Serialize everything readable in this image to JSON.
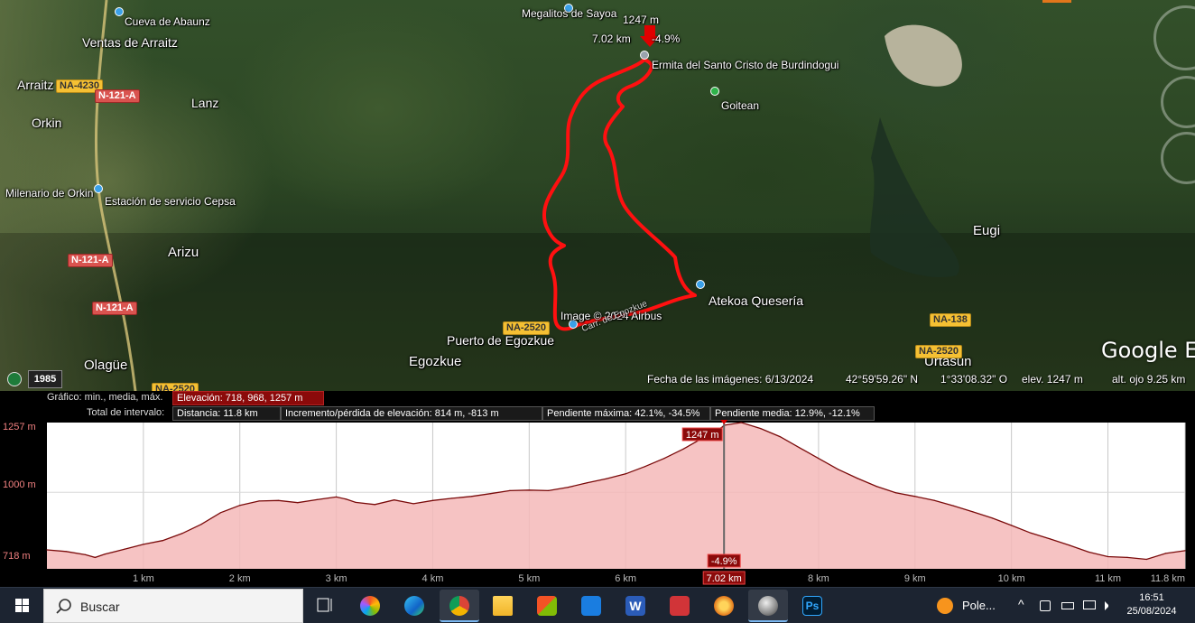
{
  "map": {
    "labels": {
      "cueva": "Cueva de Abaunz",
      "megalitos": "Megalitos de Sayoa",
      "ventas": "Ventas de Arraitz",
      "arraitz": "Arraitz",
      "lanz": "Lanz",
      "orkin": "Orkin",
      "milenario": "Milenario de Orkin",
      "cepsa": "Estación de servicio Cepsa",
      "arizu": "Arizu",
      "olague": "Olagüe",
      "ermita": "Ermita del Santo Cristo de Burdindogui",
      "goitean": "Goitean",
      "eugi": "Eugi",
      "atekoa": "Atekoa Quesería",
      "puerto": "Puerto de Egozkue",
      "egozkue": "Egozkue",
      "urtasun": "Urtasun",
      "image_credit": "Image © 2024 Airbus",
      "carr": "Carr. de Egozkue"
    },
    "roads": {
      "na4230": "NA-4230",
      "n121a_1": "N-121-A",
      "n121a_2": "N-121-A",
      "n121a_3": "N-121-A",
      "na2520_a": "NA-2520",
      "na2520_b": "NA-2520",
      "na2520_c": "NA-2520",
      "na138": "NA-138"
    },
    "cursor": {
      "elevation": "1247 m",
      "distance": "7.02 km",
      "grade": "-4.9%"
    },
    "year_button": "1985",
    "google_logo": "Google Ea",
    "status": {
      "imagery_date": "Fecha de las imágenes: 6/13/2024",
      "lat": "42°59'59.26\" N",
      "lon": "1°33'08.32\" O",
      "elev": "elev.  1247 m",
      "eye_alt": "alt. ojo   9.25 km"
    }
  },
  "profile": {
    "row1_label": "Gráfico: min., media, máx.",
    "elevation_stat": "Elevación: 718, 968, 1257 m",
    "row2_label": "Total de intervalo:",
    "distance_stat": "Distancia: 11.8 km",
    "gain_loss_stat": "Incremento/pérdida de elevación: 814 m, -813 m",
    "max_slope_stat": "Pendiente máxima: 42.1%, -34.5%",
    "avg_slope_stat": "Pendiente media: 12.9%, -12.1%",
    "y_labels": [
      "1257 m",
      "1000 m",
      "718 m"
    ],
    "cursor_elev_label": "1247 m",
    "cursor_grade_label": "-4.9%"
  },
  "chart_data": {
    "type": "area",
    "xlabel": "",
    "ylabel": "",
    "ylim": [
      718,
      1257
    ],
    "xlim": [
      0,
      11.8
    ],
    "x_ticks": [
      "1 km",
      "2 km",
      "3 km",
      "4 km",
      "5 km",
      "6 km",
      "7.02 km",
      "8 km",
      "9 km",
      "10 km",
      "11 km",
      "11.8 km"
    ],
    "x_tick_values": [
      1,
      2,
      3,
      4,
      5,
      6,
      7.02,
      8,
      9,
      10,
      11,
      11.8
    ],
    "cursor_x": 7.02,
    "series": [
      {
        "x": [
          0,
          0.2,
          0.4,
          0.5,
          0.6,
          0.8,
          1.0,
          1.2,
          1.4,
          1.6,
          1.8,
          2.0,
          2.2,
          2.4,
          2.6,
          2.8,
          3.0,
          3.1,
          3.2,
          3.4,
          3.6,
          3.8,
          4.0,
          4.2,
          4.4,
          4.6,
          4.8,
          5.0,
          5.2,
          5.4,
          5.6,
          5.8,
          6.0,
          6.2,
          6.4,
          6.6,
          6.8,
          7.0,
          7.02,
          7.2,
          7.4,
          7.6,
          7.8,
          8.0,
          8.2,
          8.4,
          8.6,
          8.8,
          9.0,
          9.2,
          9.4,
          9.6,
          9.8,
          10.0,
          10.2,
          10.4,
          10.6,
          10.8,
          11.0,
          11.2,
          11.4,
          11.6,
          11.8
        ],
        "values": [
          788,
          782,
          770,
          760,
          772,
          790,
          808,
          822,
          848,
          882,
          925,
          952,
          968,
          970,
          962,
          973,
          983,
          975,
          963,
          955,
          972,
          958,
          970,
          978,
          985,
          995,
          1006,
          1008,
          1006,
          1018,
          1035,
          1050,
          1068,
          1095,
          1125,
          1160,
          1200,
          1240,
          1247,
          1257,
          1235,
          1205,
          1165,
          1125,
          1085,
          1052,
          1022,
          998,
          985,
          970,
          950,
          928,
          905,
          878,
          850,
          828,
          805,
          780,
          763,
          760,
          753,
          775,
          785
        ]
      }
    ]
  },
  "taskbar": {
    "search_placeholder": "Buscar",
    "weather": "Pole...",
    "time": "16:51",
    "date": "25/08/2024"
  }
}
